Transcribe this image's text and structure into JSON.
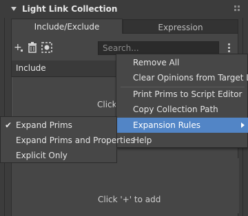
{
  "panel": {
    "title": "Light Link Collection"
  },
  "tabs": [
    {
      "label": "Include/Exclude"
    },
    {
      "label": "Expression"
    }
  ],
  "toolbar": {
    "add_label": "+",
    "search_placeholder": "Search..."
  },
  "include": {
    "header": "Include",
    "hint": "Click '+' to add"
  },
  "exclude": {
    "hint": "Click '+' to add"
  },
  "menu": {
    "items": [
      {
        "label": "Remove All"
      },
      {
        "label": "Clear Opinions from Target Layer"
      },
      {
        "label": "Print Prims to Script Editor"
      },
      {
        "label": "Copy Collection Path"
      },
      {
        "label": "Expansion Rules"
      },
      {
        "label": "Help"
      }
    ]
  },
  "submenu": {
    "items": [
      {
        "label": "Expand Prims",
        "checked": true
      },
      {
        "label": "Expand Prims and Properties",
        "checked": false
      },
      {
        "label": "Explicit Only",
        "checked": false
      }
    ]
  },
  "colors": {
    "highlight": "#5285c6",
    "panel_bg": "#464646",
    "window_bg": "#3c3c3c"
  }
}
